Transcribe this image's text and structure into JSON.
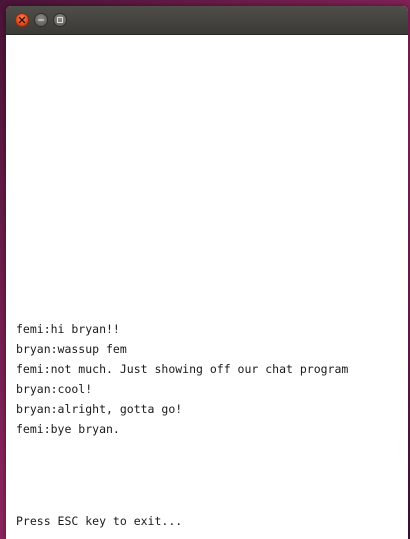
{
  "window": {
    "title": "",
    "controls": {
      "close_icon": "close-icon",
      "minimize_icon": "minimize-icon",
      "maximize_icon": "maximize-icon"
    }
  },
  "chat": {
    "messages": [
      {
        "text": "femi:hi bryan!!"
      },
      {
        "text": "bryan:wassup fem"
      },
      {
        "text": "femi:not much. Just showing off our chat program"
      },
      {
        "text": "bryan:cool!"
      },
      {
        "text": "bryan:alright, gotta go!"
      },
      {
        "text": "femi:bye bryan."
      }
    ],
    "exit_hint": "Press ESC key to exit..."
  },
  "colors": {
    "close_button": "#e2491d",
    "titlebar": "#3b3a36",
    "background": "#ffffff"
  }
}
